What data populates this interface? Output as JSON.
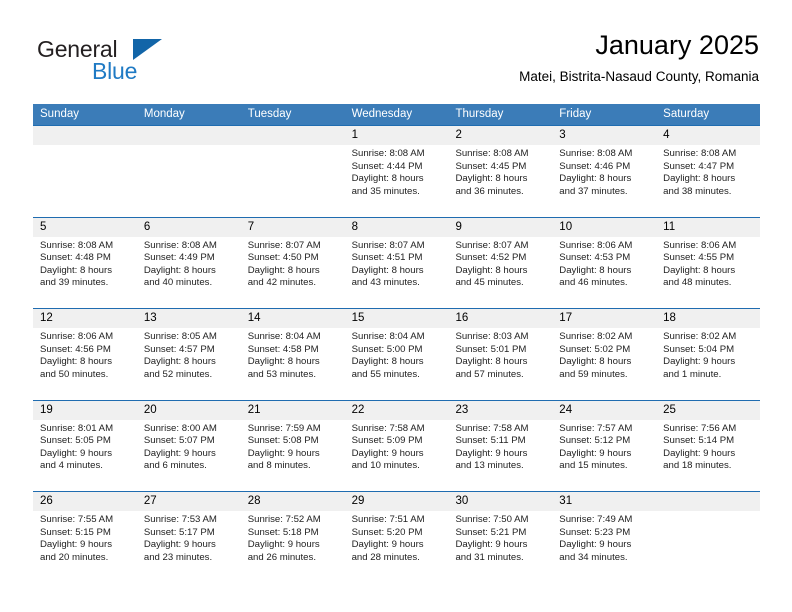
{
  "brand": {
    "name_part1": "General",
    "name_part2": "Blue",
    "flag_color": "#1265a8",
    "blue_color": "#1f7ac4"
  },
  "header": {
    "title": "January 2025",
    "location": "Matei, Bistrita-Nasaud County, Romania"
  },
  "theme": {
    "header_blue": "#3b7cb8",
    "divider_blue": "#1f6cb0",
    "date_band_gray": "#f0f0f0"
  },
  "weekdays": [
    "Sunday",
    "Monday",
    "Tuesday",
    "Wednesday",
    "Thursday",
    "Friday",
    "Saturday"
  ],
  "weeks": [
    [
      {
        "day": "",
        "sunrise": "",
        "sunset": "",
        "daylight_line1": "",
        "daylight_line2": ""
      },
      {
        "day": "",
        "sunrise": "",
        "sunset": "",
        "daylight_line1": "",
        "daylight_line2": ""
      },
      {
        "day": "",
        "sunrise": "",
        "sunset": "",
        "daylight_line1": "",
        "daylight_line2": ""
      },
      {
        "day": "1",
        "sunrise": "Sunrise: 8:08 AM",
        "sunset": "Sunset: 4:44 PM",
        "daylight_line1": "Daylight: 8 hours",
        "daylight_line2": "and 35 minutes."
      },
      {
        "day": "2",
        "sunrise": "Sunrise: 8:08 AM",
        "sunset": "Sunset: 4:45 PM",
        "daylight_line1": "Daylight: 8 hours",
        "daylight_line2": "and 36 minutes."
      },
      {
        "day": "3",
        "sunrise": "Sunrise: 8:08 AM",
        "sunset": "Sunset: 4:46 PM",
        "daylight_line1": "Daylight: 8 hours",
        "daylight_line2": "and 37 minutes."
      },
      {
        "day": "4",
        "sunrise": "Sunrise: 8:08 AM",
        "sunset": "Sunset: 4:47 PM",
        "daylight_line1": "Daylight: 8 hours",
        "daylight_line2": "and 38 minutes."
      }
    ],
    [
      {
        "day": "5",
        "sunrise": "Sunrise: 8:08 AM",
        "sunset": "Sunset: 4:48 PM",
        "daylight_line1": "Daylight: 8 hours",
        "daylight_line2": "and 39 minutes."
      },
      {
        "day": "6",
        "sunrise": "Sunrise: 8:08 AM",
        "sunset": "Sunset: 4:49 PM",
        "daylight_line1": "Daylight: 8 hours",
        "daylight_line2": "and 40 minutes."
      },
      {
        "day": "7",
        "sunrise": "Sunrise: 8:07 AM",
        "sunset": "Sunset: 4:50 PM",
        "daylight_line1": "Daylight: 8 hours",
        "daylight_line2": "and 42 minutes."
      },
      {
        "day": "8",
        "sunrise": "Sunrise: 8:07 AM",
        "sunset": "Sunset: 4:51 PM",
        "daylight_line1": "Daylight: 8 hours",
        "daylight_line2": "and 43 minutes."
      },
      {
        "day": "9",
        "sunrise": "Sunrise: 8:07 AM",
        "sunset": "Sunset: 4:52 PM",
        "daylight_line1": "Daylight: 8 hours",
        "daylight_line2": "and 45 minutes."
      },
      {
        "day": "10",
        "sunrise": "Sunrise: 8:06 AM",
        "sunset": "Sunset: 4:53 PM",
        "daylight_line1": "Daylight: 8 hours",
        "daylight_line2": "and 46 minutes."
      },
      {
        "day": "11",
        "sunrise": "Sunrise: 8:06 AM",
        "sunset": "Sunset: 4:55 PM",
        "daylight_line1": "Daylight: 8 hours",
        "daylight_line2": "and 48 minutes."
      }
    ],
    [
      {
        "day": "12",
        "sunrise": "Sunrise: 8:06 AM",
        "sunset": "Sunset: 4:56 PM",
        "daylight_line1": "Daylight: 8 hours",
        "daylight_line2": "and 50 minutes."
      },
      {
        "day": "13",
        "sunrise": "Sunrise: 8:05 AM",
        "sunset": "Sunset: 4:57 PM",
        "daylight_line1": "Daylight: 8 hours",
        "daylight_line2": "and 52 minutes."
      },
      {
        "day": "14",
        "sunrise": "Sunrise: 8:04 AM",
        "sunset": "Sunset: 4:58 PM",
        "daylight_line1": "Daylight: 8 hours",
        "daylight_line2": "and 53 minutes."
      },
      {
        "day": "15",
        "sunrise": "Sunrise: 8:04 AM",
        "sunset": "Sunset: 5:00 PM",
        "daylight_line1": "Daylight: 8 hours",
        "daylight_line2": "and 55 minutes."
      },
      {
        "day": "16",
        "sunrise": "Sunrise: 8:03 AM",
        "sunset": "Sunset: 5:01 PM",
        "daylight_line1": "Daylight: 8 hours",
        "daylight_line2": "and 57 minutes."
      },
      {
        "day": "17",
        "sunrise": "Sunrise: 8:02 AM",
        "sunset": "Sunset: 5:02 PM",
        "daylight_line1": "Daylight: 8 hours",
        "daylight_line2": "and 59 minutes."
      },
      {
        "day": "18",
        "sunrise": "Sunrise: 8:02 AM",
        "sunset": "Sunset: 5:04 PM",
        "daylight_line1": "Daylight: 9 hours",
        "daylight_line2": "and 1 minute."
      }
    ],
    [
      {
        "day": "19",
        "sunrise": "Sunrise: 8:01 AM",
        "sunset": "Sunset: 5:05 PM",
        "daylight_line1": "Daylight: 9 hours",
        "daylight_line2": "and 4 minutes."
      },
      {
        "day": "20",
        "sunrise": "Sunrise: 8:00 AM",
        "sunset": "Sunset: 5:07 PM",
        "daylight_line1": "Daylight: 9 hours",
        "daylight_line2": "and 6 minutes."
      },
      {
        "day": "21",
        "sunrise": "Sunrise: 7:59 AM",
        "sunset": "Sunset: 5:08 PM",
        "daylight_line1": "Daylight: 9 hours",
        "daylight_line2": "and 8 minutes."
      },
      {
        "day": "22",
        "sunrise": "Sunrise: 7:58 AM",
        "sunset": "Sunset: 5:09 PM",
        "daylight_line1": "Daylight: 9 hours",
        "daylight_line2": "and 10 minutes."
      },
      {
        "day": "23",
        "sunrise": "Sunrise: 7:58 AM",
        "sunset": "Sunset: 5:11 PM",
        "daylight_line1": "Daylight: 9 hours",
        "daylight_line2": "and 13 minutes."
      },
      {
        "day": "24",
        "sunrise": "Sunrise: 7:57 AM",
        "sunset": "Sunset: 5:12 PM",
        "daylight_line1": "Daylight: 9 hours",
        "daylight_line2": "and 15 minutes."
      },
      {
        "day": "25",
        "sunrise": "Sunrise: 7:56 AM",
        "sunset": "Sunset: 5:14 PM",
        "daylight_line1": "Daylight: 9 hours",
        "daylight_line2": "and 18 minutes."
      }
    ],
    [
      {
        "day": "26",
        "sunrise": "Sunrise: 7:55 AM",
        "sunset": "Sunset: 5:15 PM",
        "daylight_line1": "Daylight: 9 hours",
        "daylight_line2": "and 20 minutes."
      },
      {
        "day": "27",
        "sunrise": "Sunrise: 7:53 AM",
        "sunset": "Sunset: 5:17 PM",
        "daylight_line1": "Daylight: 9 hours",
        "daylight_line2": "and 23 minutes."
      },
      {
        "day": "28",
        "sunrise": "Sunrise: 7:52 AM",
        "sunset": "Sunset: 5:18 PM",
        "daylight_line1": "Daylight: 9 hours",
        "daylight_line2": "and 26 minutes."
      },
      {
        "day": "29",
        "sunrise": "Sunrise: 7:51 AM",
        "sunset": "Sunset: 5:20 PM",
        "daylight_line1": "Daylight: 9 hours",
        "daylight_line2": "and 28 minutes."
      },
      {
        "day": "30",
        "sunrise": "Sunrise: 7:50 AM",
        "sunset": "Sunset: 5:21 PM",
        "daylight_line1": "Daylight: 9 hours",
        "daylight_line2": "and 31 minutes."
      },
      {
        "day": "31",
        "sunrise": "Sunrise: 7:49 AM",
        "sunset": "Sunset: 5:23 PM",
        "daylight_line1": "Daylight: 9 hours",
        "daylight_line2": "and 34 minutes."
      },
      {
        "day": "",
        "sunrise": "",
        "sunset": "",
        "daylight_line1": "",
        "daylight_line2": ""
      }
    ]
  ]
}
